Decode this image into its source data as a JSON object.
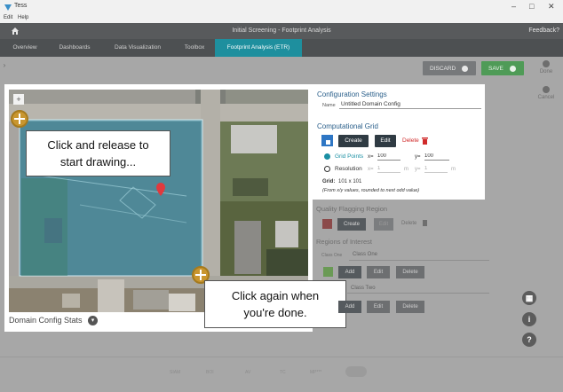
{
  "window": {
    "title": "Tess",
    "menu": [
      "Edit",
      "Help"
    ]
  },
  "appbar": {
    "title": "Initial Screening - Footprint Analysis",
    "feedback": "Feedback?"
  },
  "tabs": [
    "Overview",
    "Dashboards",
    "Data Visualization",
    "Toolbox",
    "Footprint Analysis (ETR)"
  ],
  "toolbar": {
    "discard": "DISCARD",
    "save": "SAVE",
    "done": "Done",
    "cancel": "Cancel",
    "left_arrow": "›"
  },
  "map": {
    "callout_start_1": "Click and release to",
    "callout_start_2": "start drawing...",
    "callout_end_1": "Click again when",
    "callout_end_2": "you're done.",
    "stats_label": "Domain Config Stats"
  },
  "config": {
    "title": "Configuration Settings",
    "name_label": "Name",
    "name_value": "Untitled Domain Config",
    "grid_title": "Computational Grid",
    "create": "Create",
    "edit": "Edit",
    "delete": "Delete",
    "grid_points_label": "Grid Points",
    "x_label": "x=",
    "x_value": "100",
    "y_label": "y=",
    "y_value": "100",
    "resolution_label": "Resolution",
    "res_x_label": "x=",
    "res_x_value": "1",
    "res_x_unit": "m",
    "res_y_label": "y=",
    "res_y_value": "1",
    "res_y_unit": "m",
    "grid_summary_label": "Grid:",
    "grid_summary_value": "101 x 101",
    "grid_note": "(From x/y values, rounded to next odd value)"
  },
  "quality": {
    "title": "Quality Flagging Region",
    "create": "Create",
    "edit": "Edit",
    "delete": "Delete"
  },
  "roi": {
    "title": "Regions of Interest",
    "class_one_label": "Class One",
    "class_one_value": "Class One",
    "class_two_value": "Class Two",
    "add": "Add",
    "edit": "Edit",
    "delete": "Delete"
  },
  "side_buttons": {
    "grid": "▦",
    "info": "i",
    "help": "?"
  },
  "bottom_bar": [
    "SIAM",
    "BOI",
    "AV",
    "TC",
    "MP***"
  ],
  "colors": {
    "accent": "#1e8f9e",
    "save": "#4f9b57",
    "delete": "#d02a2a",
    "grid_overlay": "#2a8fb0"
  }
}
